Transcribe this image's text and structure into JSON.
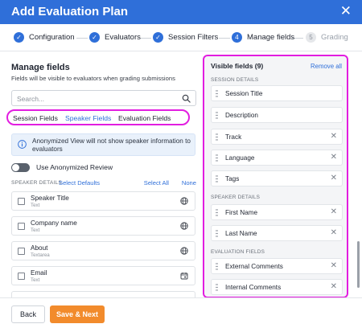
{
  "dialog": {
    "title": "Add Evaluation Plan",
    "close_icon": "close-icon"
  },
  "stepper": {
    "steps": [
      {
        "label": "Configuration",
        "state": "done",
        "marker": "✓"
      },
      {
        "label": "Evaluators",
        "state": "done",
        "marker": "✓"
      },
      {
        "label": "Session Filters",
        "state": "done",
        "marker": "✓"
      },
      {
        "label": "Manage fields",
        "state": "current",
        "marker": "4"
      },
      {
        "label": "Grading",
        "state": "upcoming",
        "marker": "5"
      }
    ]
  },
  "manage": {
    "heading": "Manage fields",
    "subtitle": "Fields will be visible to evaluators when grading submissions",
    "search": {
      "placeholder": "Search...",
      "value": "",
      "icon": "search-icon"
    },
    "tabs": [
      {
        "label": "Session Fields",
        "active": false
      },
      {
        "label": "Speaker Fields",
        "active": true
      },
      {
        "label": "Evaluation Fields",
        "active": false
      }
    ],
    "info_text": "Anonymized View will not show speaker information to evaluators",
    "toggle": {
      "label": "Use Anonymized Review",
      "on": false
    },
    "section": {
      "label": "SPEAKER DETAILS",
      "select_defaults": "Select Defaults",
      "select_all": "Select All",
      "none": "None"
    },
    "fields": [
      {
        "name": "Speaker Title",
        "type": "Text",
        "icon": "globe-icon"
      },
      {
        "name": "Company name",
        "type": "Text",
        "icon": "globe-icon"
      },
      {
        "name": "About",
        "type": "Textarea",
        "icon": "globe-icon"
      },
      {
        "name": "Email",
        "type": "Text",
        "icon": "calendar-icon"
      }
    ]
  },
  "visible": {
    "title": "Visible fields (9)",
    "remove_all": "Remove all",
    "sections": {
      "session": "SESSION DETAILS",
      "speaker": "SPEAKER DETAILS",
      "evaluation": "EVALUATION FIELDS"
    },
    "session_fields": [
      "Session Title",
      "Description",
      "Track",
      "Language",
      "Tags"
    ],
    "speaker_fields": [
      "First Name",
      "Last Name"
    ],
    "evaluation_fields": [
      "External Comments",
      "Internal Comments"
    ]
  },
  "footer": {
    "back": "Back",
    "next": "Save & Next"
  },
  "colors": {
    "primary": "#2f6fd9",
    "accent": "#f28b2c",
    "highlight": "#e21de0"
  }
}
